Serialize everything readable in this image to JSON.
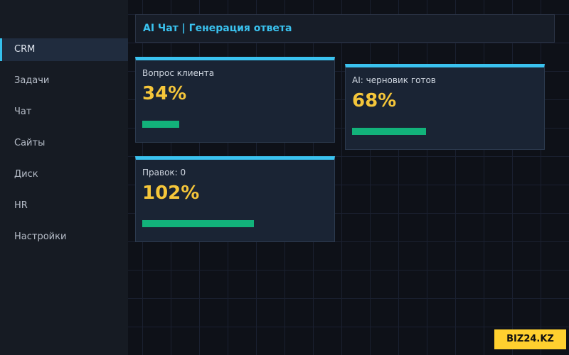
{
  "sidebar": {
    "items": [
      {
        "label": "CRM",
        "active": true
      },
      {
        "label": "Задачи",
        "active": false
      },
      {
        "label": "Чат",
        "active": false
      },
      {
        "label": "Сайты",
        "active": false
      },
      {
        "label": "Диск",
        "active": false
      },
      {
        "label": "HR",
        "active": false
      },
      {
        "label": "Настройки",
        "active": false
      }
    ]
  },
  "header": {
    "title": "AI Чат | Генерация ответа"
  },
  "cards": [
    {
      "label": "Вопрос клиента",
      "value": "34%",
      "progress": 0.34
    },
    {
      "label": "AI: черновик готов",
      "value": "68%",
      "progress": 0.68
    },
    {
      "label": "Правок: 0",
      "value": "102%",
      "progress": 1.02
    }
  ],
  "watermark": {
    "text": "BIZ24.KZ"
  },
  "colors": {
    "accent": "#3ac2ef",
    "value": "#f5c63a",
    "progress": "#12b27a",
    "watermark_bg": "#ffd02f"
  }
}
